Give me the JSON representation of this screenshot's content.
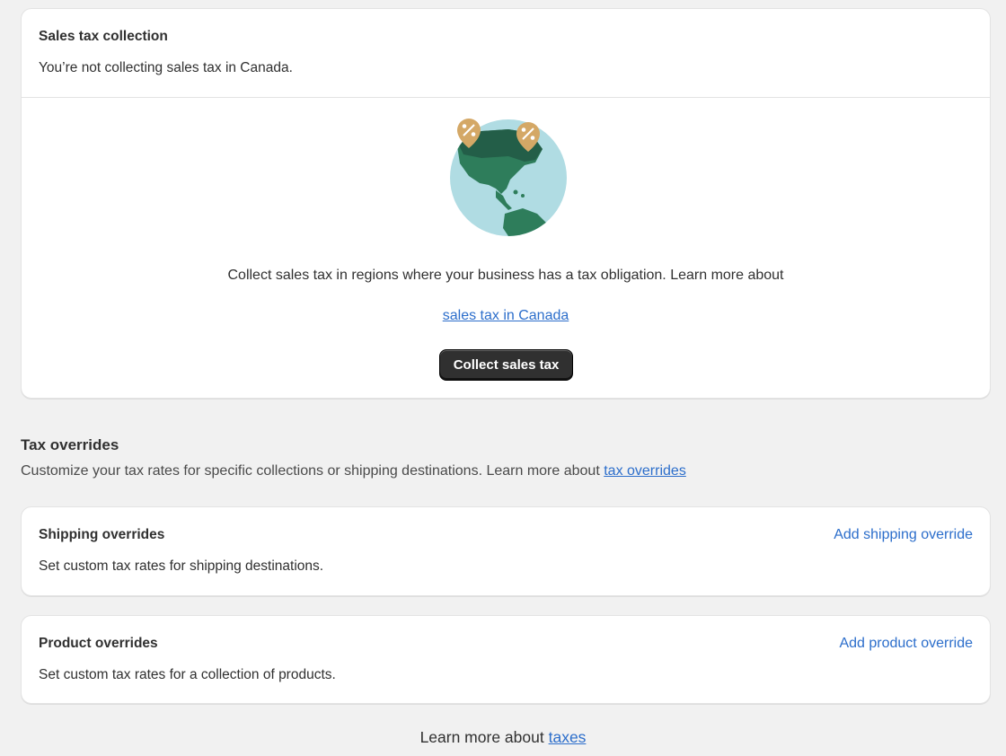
{
  "sales_tax": {
    "title": "Sales tax collection",
    "subtitle": "You’re not collecting sales tax in Canada.",
    "illustration_icon": "globe-tax-icon",
    "empty_text": "Collect sales tax in regions where your business has a tax obligation. Learn more about",
    "learn_link": "sales tax in Canada",
    "button_label": "Collect sales tax"
  },
  "tax_overrides": {
    "title": "Tax overrides",
    "description": "Customize your tax rates for specific collections or shipping destinations. Learn more about",
    "link": "tax overrides"
  },
  "shipping_overrides": {
    "title": "Shipping overrides",
    "text": "Set custom tax rates for shipping destinations.",
    "action": "Add shipping override"
  },
  "product_overrides": {
    "title": "Product overrides",
    "text": "Set custom tax rates for a collection of products.",
    "action": "Add product override"
  },
  "footer": {
    "text": "Learn more about",
    "link": "taxes"
  },
  "colors": {
    "accent_link": "#2c6ecb",
    "button_bg": "#303030",
    "globe_ocean": "#b0dce3",
    "globe_land": "#2e7d5b",
    "pin": "#d4a866"
  }
}
